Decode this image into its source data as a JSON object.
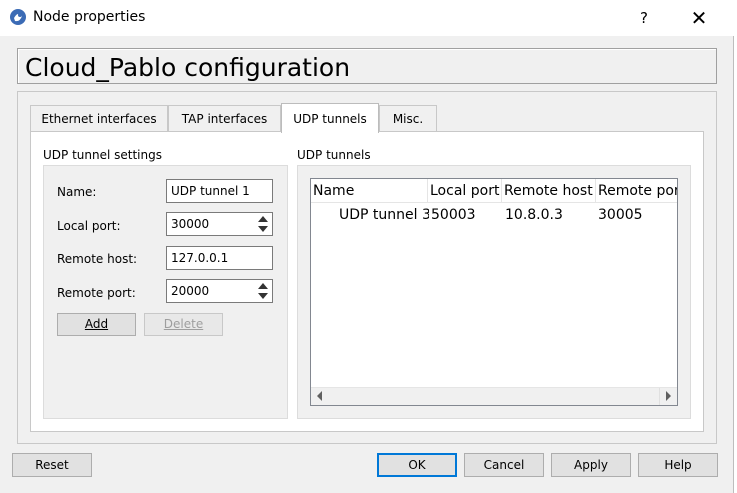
{
  "window": {
    "title": "Node properties",
    "help_label": "?",
    "close_label": "✕"
  },
  "heading": "Cloud_Pablo configuration",
  "tabs": [
    {
      "label": "Ethernet interfaces",
      "active": false
    },
    {
      "label": "TAP interfaces",
      "active": false
    },
    {
      "label": "UDP tunnels",
      "active": true
    },
    {
      "label": "Misc.",
      "active": false
    }
  ],
  "settings": {
    "group_label": "UDP tunnel settings",
    "name_label": "Name:",
    "name_value": "UDP tunnel 1",
    "local_port_label": "Local port:",
    "local_port_value": "30000",
    "remote_host_label": "Remote host:",
    "remote_host_value": "127.0.0.1",
    "remote_port_label": "Remote port:",
    "remote_port_value": "20000",
    "add_label": "Add",
    "delete_label": "Delete"
  },
  "tunnels": {
    "group_label": "UDP tunnels",
    "columns": [
      "Name",
      "Local port",
      "Remote host",
      "Remote por"
    ],
    "rows": [
      [
        "UDP tunnel 3",
        "50003",
        "10.8.0.3",
        "30005"
      ]
    ]
  },
  "footer": {
    "reset": "Reset",
    "ok": "OK",
    "cancel": "Cancel",
    "apply": "Apply",
    "help": "Help"
  },
  "colors": {
    "accent": "#0078d7",
    "window_bg": "#f0f0f0"
  },
  "icons": {
    "app": "gns3-icon",
    "help": "question-icon",
    "close": "close-icon"
  }
}
